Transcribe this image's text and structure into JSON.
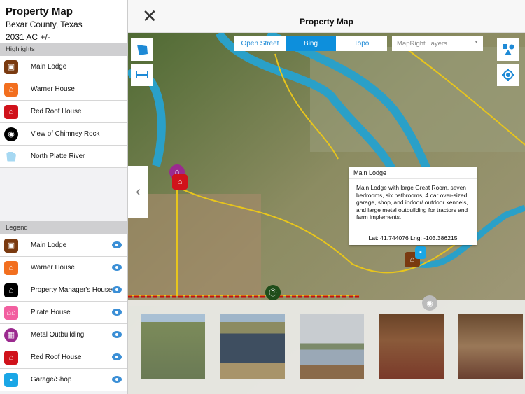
{
  "sidebar": {
    "title": "Property Map",
    "location": "Bexar County, Texas",
    "acreage": "2031 AC +/-",
    "highlights_header": "Highlights",
    "highlights": [
      {
        "label": "Main Lodge",
        "icon": "lodge-icon",
        "color": "#7a3a10"
      },
      {
        "label": "Warner House",
        "icon": "house-icon",
        "color": "#f26f1f"
      },
      {
        "label": "Red Roof House",
        "icon": "house-icon",
        "color": "#d0121b"
      },
      {
        "label": "View of Chimney Rock",
        "icon": "camera-icon",
        "color": "#000000"
      },
      {
        "label": "North Platte River",
        "icon": "river-icon",
        "color": "#a6d8f2"
      }
    ],
    "legend_header": "Legend",
    "legend": [
      {
        "label": "Main Lodge",
        "icon": "lodge-icon",
        "color": "#7a3a10"
      },
      {
        "label": "Warner House",
        "icon": "house-icon",
        "color": "#f26f1f"
      },
      {
        "label": "Property Manager's House",
        "icon": "house-icon",
        "color": "#000000"
      },
      {
        "label": "Pirate House",
        "icon": "houses-icon",
        "color": "#f25fa0"
      },
      {
        "label": "Metal Outbuilding",
        "icon": "barn-icon",
        "color": "#9b2a8f"
      },
      {
        "label": "Red Roof House",
        "icon": "house-icon",
        "color": "#d0121b"
      },
      {
        "label": "Garage/Shop",
        "icon": "garage-icon",
        "color": "#1aa6e6"
      }
    ]
  },
  "header": {
    "title": "Property Map",
    "close_icon": "close-icon"
  },
  "map": {
    "base_layers": [
      "Open Street",
      "Bing",
      "Topo"
    ],
    "selected_layer": "Bing",
    "layers_dropdown": "MapRight Layers",
    "accent": "#0d8fdc",
    "popup": {
      "title": "Main Lodge",
      "body": "Main Lodge with large Great Room, seven bedrooms, six bathrooms, 4 car over-sized garage, shop, and indoor/ outdoor kennels, and large metal outbuilding for tractors and farm implements.",
      "coords": "Lat: 41.744076 Lng: -103.386215"
    }
  }
}
